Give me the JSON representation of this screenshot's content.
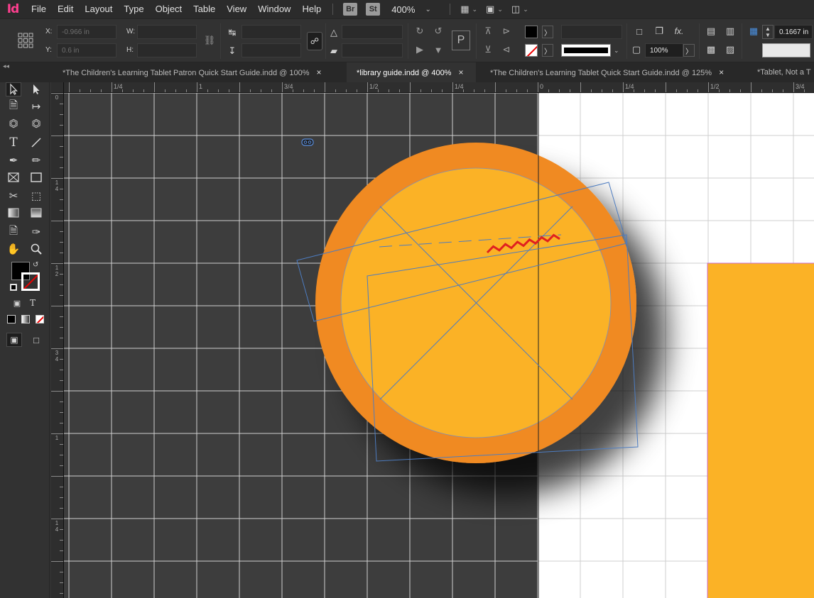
{
  "app": {
    "logo": "Id"
  },
  "menu": [
    "File",
    "Edit",
    "Layout",
    "Type",
    "Object",
    "Table",
    "View",
    "Window",
    "Help"
  ],
  "menubar": {
    "bridge_label": "Br",
    "stock_label": "St",
    "zoom": "400%"
  },
  "control_panel": {
    "x_label": "X:",
    "x_value": "-0.966 in",
    "y_label": "Y:",
    "y_value": "0.6 in",
    "w_label": "W:",
    "w_value": "",
    "h_label": "H:",
    "h_value": "",
    "stroke_weight": "0.1667 in",
    "opacity": "100%",
    "fx_label": "fx."
  },
  "tabs": [
    {
      "label": "*The Children's Learning Tablet Patron Quick Start Guide.indd @ 100%",
      "active": false,
      "close": "×"
    },
    {
      "label": "*library guide.indd @ 400%",
      "active": true,
      "close": "×"
    },
    {
      "label": "*The Children's Learning Tablet Quick Start Guide.indd @ 125%",
      "active": false,
      "close": "×"
    },
    {
      "label": "*Tablet, Not a T",
      "active": false,
      "close": ""
    }
  ],
  "rulers": {
    "horizontal": [
      {
        "label": "1/4"
      },
      {
        "label": "1"
      },
      {
        "label": "3/4"
      },
      {
        "label": "1/2"
      },
      {
        "label": "1/4"
      },
      {
        "label": "0"
      },
      {
        "label": "1/4"
      },
      {
        "label": "1/2"
      },
      {
        "label": "3/4"
      }
    ],
    "vertical": [
      {
        "label": "0"
      },
      {
        "label": "1 4"
      },
      {
        "label": "1 2"
      },
      {
        "label": "3 4"
      },
      {
        "label": "1"
      },
      {
        "label": "1 4"
      }
    ]
  },
  "toolbox": {
    "type_tool": "T",
    "formatting_text": "T",
    "collapse": "◂◂"
  },
  "colors": {
    "pasteboard": "#3d3d3d",
    "page": "#ffffff",
    "grid_dark": "#d0d0d0",
    "grid_light": "#c8c8c8",
    "circle_outer": "#f08a24",
    "circle_inner": "#fbb226",
    "frame_stroke": "#4d7cc0",
    "squiggle": "#e02020",
    "rect_fill": "#fbb226"
  }
}
